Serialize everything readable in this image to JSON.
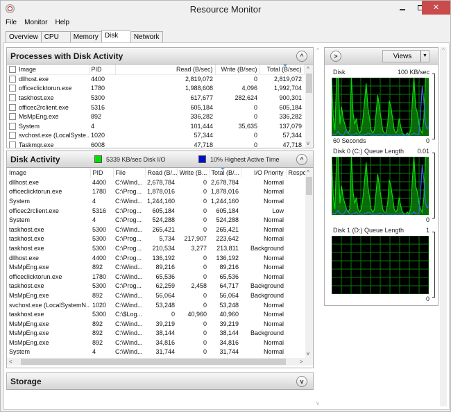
{
  "window": {
    "title": "Resource Monitor",
    "icon": "resource-monitor-icon",
    "controls": {
      "minimize": "minimize-icon",
      "maximize": "maximize-icon",
      "close": "✕"
    }
  },
  "menu": [
    "File",
    "Monitor",
    "Help"
  ],
  "tabs": [
    {
      "label": "Overview",
      "active": false
    },
    {
      "label": "CPU",
      "active": false
    },
    {
      "label": "Memory",
      "active": false
    },
    {
      "label": "Disk",
      "active": true
    },
    {
      "label": "Network",
      "active": false
    }
  ],
  "processes": {
    "title": "Processes with Disk Activity",
    "columns": [
      "Image",
      "PID",
      "Read (B/sec)",
      "Write (B/sec)",
      "Total (B/sec)"
    ],
    "sorted_column": "Total (B/sec)",
    "rows": [
      [
        "dllhost.exe",
        "4400",
        "2,819,072",
        "0",
        "2,819,072"
      ],
      [
        "officeclicktorun.exe",
        "1780",
        "1,988,608",
        "4,096",
        "1,992,704"
      ],
      [
        "taskhost.exe",
        "5300",
        "617,677",
        "282,624",
        "900,301"
      ],
      [
        "officec2rclient.exe",
        "5316",
        "605,184",
        "0",
        "605,184"
      ],
      [
        "MsMpEng.exe",
        "892",
        "336,282",
        "0",
        "336,282"
      ],
      [
        "System",
        "4",
        "101,444",
        "35,635",
        "137,079"
      ],
      [
        "svchost.exe (LocalSyste...",
        "1020",
        "57,344",
        "0",
        "57,344"
      ],
      [
        "Taskmgr.exe",
        "6008",
        "47,718",
        "0",
        "47,718"
      ]
    ]
  },
  "disk_activity": {
    "title": "Disk Activity",
    "legend": [
      {
        "label": "5339 KB/sec Disk I/O",
        "color": "#00e000"
      },
      {
        "label": "10% Highest Active Time",
        "color": "#0010c8"
      }
    ],
    "columns": [
      "Image",
      "PID",
      "File",
      "Read (B/...",
      "Write (B...",
      "Total (B/...",
      "I/O Priority",
      "Respo"
    ],
    "sorted_column": "Total (B/...",
    "rows": [
      [
        "dllhost.exe",
        "4400",
        "C:\\Wind...",
        "2,678,784",
        "0",
        "2,678,784",
        "Normal"
      ],
      [
        "officeclicktorun.exe",
        "1780",
        "C:\\Prog...",
        "1,878,016",
        "0",
        "1,878,016",
        "Normal"
      ],
      [
        "System",
        "4",
        "C:\\Wind...",
        "1,244,160",
        "0",
        "1,244,160",
        "Normal"
      ],
      [
        "officec2rclient.exe",
        "5316",
        "C:\\Prog...",
        "605,184",
        "0",
        "605,184",
        "Low"
      ],
      [
        "System",
        "4",
        "C:\\Prog...",
        "524,288",
        "0",
        "524,288",
        "Normal"
      ],
      [
        "taskhost.exe",
        "5300",
        "C:\\Wind...",
        "265,421",
        "0",
        "265,421",
        "Normal"
      ],
      [
        "taskhost.exe",
        "5300",
        "C:\\Prog...",
        "5,734",
        "217,907",
        "223,642",
        "Normal"
      ],
      [
        "taskhost.exe",
        "5300",
        "C:\\Prog...",
        "210,534",
        "3,277",
        "213,811",
        "Background"
      ],
      [
        "dllhost.exe",
        "4400",
        "C:\\Prog...",
        "136,192",
        "0",
        "136,192",
        "Normal"
      ],
      [
        "MsMpEng.exe",
        "892",
        "C:\\Wind...",
        "89,216",
        "0",
        "89,216",
        "Normal"
      ],
      [
        "officeclicktorun.exe",
        "1780",
        "C:\\Wind...",
        "65,536",
        "0",
        "65,536",
        "Normal"
      ],
      [
        "taskhost.exe",
        "5300",
        "C:\\Prog...",
        "62,259",
        "2,458",
        "64,717",
        "Background"
      ],
      [
        "MsMpEng.exe",
        "892",
        "C:\\Wind...",
        "56,064",
        "0",
        "56,064",
        "Background"
      ],
      [
        "svchost.exe (LocalSystemN...",
        "1020",
        "C:\\Wind...",
        "53,248",
        "0",
        "53,248",
        "Normal"
      ],
      [
        "taskhost.exe",
        "5300",
        "C:\\$Log...",
        "0",
        "40,960",
        "40,960",
        "Normal"
      ],
      [
        "MsMpEng.exe",
        "892",
        "C:\\Wind...",
        "39,219",
        "0",
        "39,219",
        "Normal"
      ],
      [
        "MsMpEng.exe",
        "892",
        "C:\\Wind...",
        "38,144",
        "0",
        "38,144",
        "Background"
      ],
      [
        "MsMpEng.exe",
        "892",
        "C:\\Wind...",
        "34,816",
        "0",
        "34,816",
        "Normal"
      ],
      [
        "System",
        "4",
        "C:\\Wind...",
        "31,744",
        "0",
        "31,744",
        "Normal"
      ]
    ]
  },
  "storage": {
    "title": "Storage"
  },
  "right_panel": {
    "views_label": "Views",
    "graphs": [
      {
        "title": "Disk",
        "max": "100 KB/sec",
        "min": "0",
        "sub": "60 Seconds",
        "series": "active"
      },
      {
        "title": "Disk 0 (C:) Queue Length",
        "max": "0.01",
        "min": "0",
        "sub": "",
        "series": "active"
      },
      {
        "title": "Disk 1 (D:) Queue Length",
        "max": "1",
        "min": "0",
        "sub": "",
        "series": "empty"
      }
    ],
    "colors": {
      "grid": "#0a7a0a",
      "io": "#00e000",
      "io_fill": "#0b6b0b",
      "active": "#3d6be0"
    }
  }
}
